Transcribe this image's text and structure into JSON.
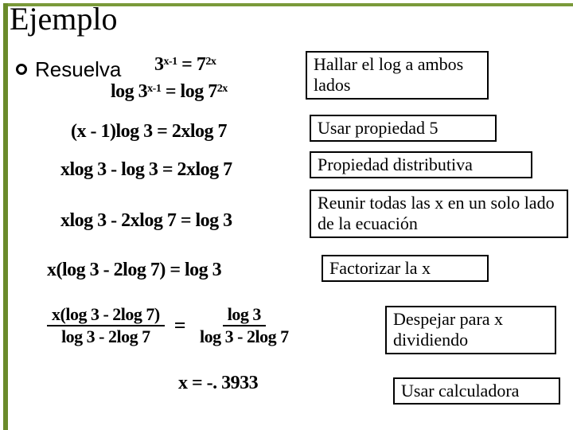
{
  "title": "Ejemplo",
  "bullet": "Resuelva",
  "eq": {
    "e1_a": "3",
    "e1_sup1": "x-1",
    "e1_mid": " = 7",
    "e1_sup2": "2x",
    "e2_a": "log 3",
    "e2_sup1": "x-1",
    "e2_mid": " = log 7",
    "e2_sup2": "2x",
    "e3": "(x - 1)log 3 = 2xlog 7",
    "e4": "xlog 3 - log 3 = 2xlog 7",
    "e5": "xlog 3 - 2xlog 7 = log 3",
    "e6": "x(log 3 - 2log 7) = log 3",
    "e7_num1": "x(log 3 - 2log 7)",
    "e7_den1": "log 3 - 2log 7",
    "e7_eq": "=",
    "e7_num2": "log 3",
    "e7_den2": "log 3 - 2log 7",
    "e8": "x = -. 3933"
  },
  "boxes": {
    "b1": "Hallar el log a ambos lados",
    "b2": "Usar propiedad 5",
    "b3": "Propiedad distributiva",
    "b4": "Reunir todas las x en un solo lado de la ecuación",
    "b5": "Factorizar la x",
    "b6": "Despejar para x dividiendo",
    "b7": "Usar calculadora"
  }
}
